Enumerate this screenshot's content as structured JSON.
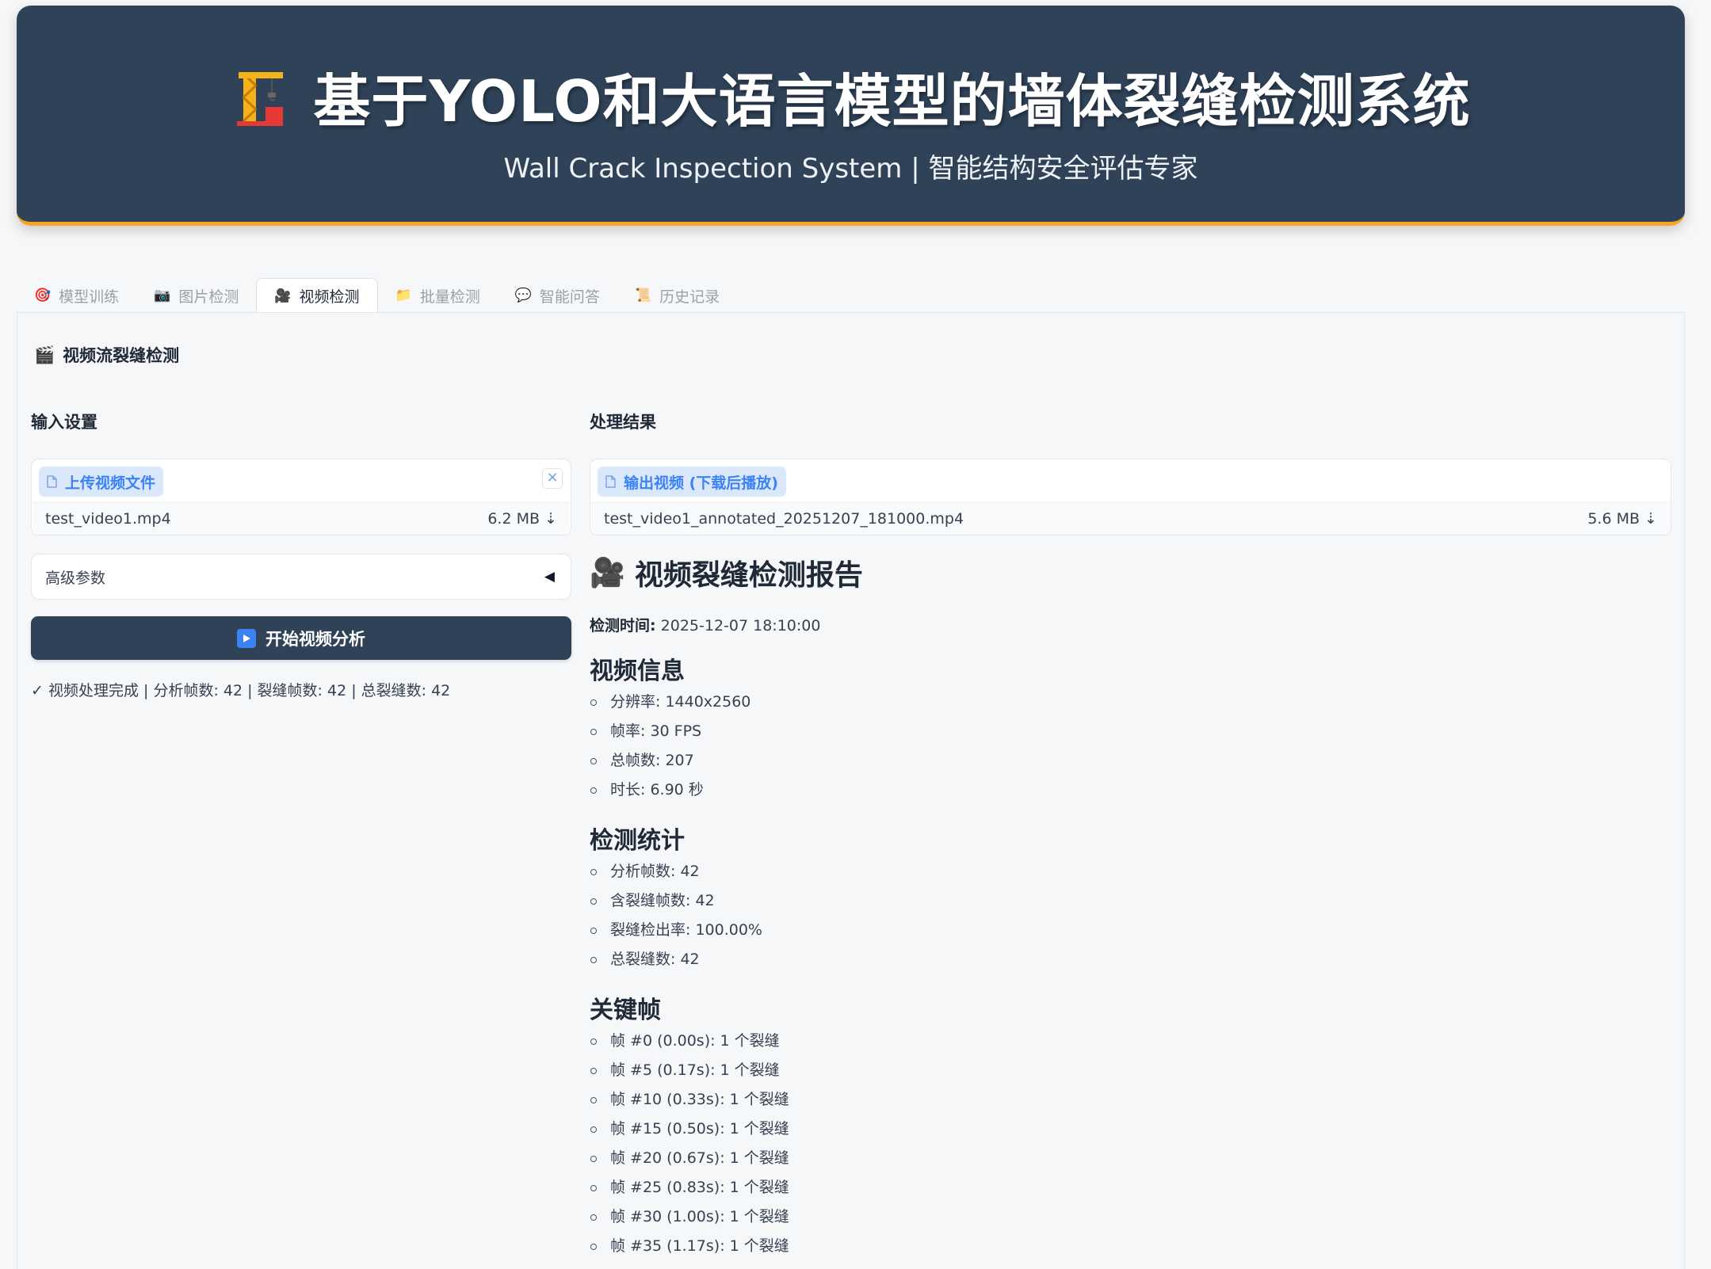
{
  "header": {
    "title": "基于YOLO和大语言模型的墙体裂缝检测系统",
    "subtitle": "Wall Crack Inspection System | 智能结构安全评估专家"
  },
  "tabs": [
    {
      "icon": "target-icon",
      "label": "模型训练"
    },
    {
      "icon": "camera-icon",
      "label": "图片检测"
    },
    {
      "icon": "video-camera-icon",
      "label": "视频检测",
      "active": true
    },
    {
      "icon": "folder-icon",
      "label": "批量检测"
    },
    {
      "icon": "speech-bubble-icon",
      "label": "智能问答"
    },
    {
      "icon": "scroll-icon",
      "label": "历史记录"
    }
  ],
  "section_title": "视频流裂缝检测",
  "input": {
    "heading": "输入设置",
    "upload_label": "上传视频文件",
    "file_name": "test_video1.mp4",
    "file_size": "6.2 MB ⇣",
    "advanced_label": "高级参数",
    "advanced_arrow": "◀",
    "start_button": "开始视频分析",
    "status": "✓ 视频处理完成 | 分析帧数: 42 | 裂缝帧数: 42 | 总裂缝数: 42"
  },
  "output": {
    "heading": "处理结果",
    "video_label": "输出视频 (下载后播放)",
    "file_name": "test_video1_annotated_20251207_181000.mp4",
    "file_size": "5.6 MB ⇣"
  },
  "report": {
    "title": "视频裂缝检测报告",
    "time_label": "检测时间:",
    "time_value": "2025-12-07 18:10:00",
    "video_info_heading": "视频信息",
    "video_info": [
      "分辨率: 1440x2560",
      "帧率: 30 FPS",
      "总帧数: 207",
      "时长: 6.90 秒"
    ],
    "stats_heading": "检测统计",
    "stats": [
      "分析帧数: 42",
      "含裂缝帧数: 42",
      "裂缝检出率: 100.00%",
      "总裂缝数: 42"
    ],
    "keyframes_heading": "关键帧",
    "keyframes": [
      "帧 #0 (0.00s): 1 个裂缝",
      "帧 #5 (0.17s): 1 个裂缝",
      "帧 #10 (0.33s): 1 个裂缝",
      "帧 #15 (0.50s): 1 个裂缝",
      "帧 #20 (0.67s): 1 个裂缝",
      "帧 #25 (0.83s): 1 个裂缝",
      "帧 #30 (1.00s): 1 个裂缝",
      "帧 #35 (1.17s): 1 个裂缝"
    ]
  },
  "colors": {
    "header_bg": "#2f4258",
    "header_accent": "#f5a623",
    "link_blue": "#3b82f6",
    "button_bg": "#2f4258"
  }
}
